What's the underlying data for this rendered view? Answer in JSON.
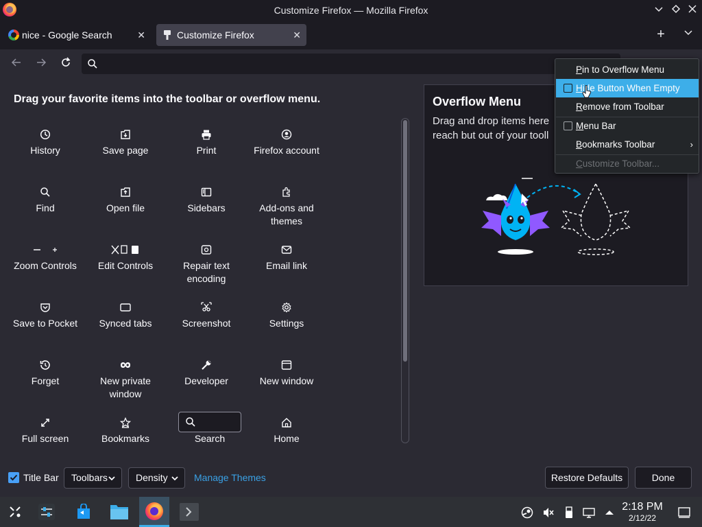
{
  "window": {
    "title": "Customize Firefox — Mozilla Firefox"
  },
  "tabs": [
    {
      "label": "nice - Google Search",
      "icon": "google-icon",
      "active": false
    },
    {
      "label": "Customize Firefox",
      "icon": "paintbrush-icon",
      "active": true
    }
  ],
  "navbar": {
    "url_value": ""
  },
  "customize": {
    "heading": "Drag your favorite items into the toolbar or overflow menu.",
    "items": [
      {
        "label": "History",
        "icon": "history-icon"
      },
      {
        "label": "Save page",
        "icon": "save-page-icon"
      },
      {
        "label": "Print",
        "icon": "print-icon"
      },
      {
        "label": "Firefox account",
        "icon": "account-icon"
      },
      {
        "label": "Find",
        "icon": "find-icon"
      },
      {
        "label": "Open file",
        "icon": "open-file-icon"
      },
      {
        "label": "Sidebars",
        "icon": "sidebars-icon"
      },
      {
        "label": "Add-ons and themes",
        "icon": "addons-icon"
      },
      {
        "label": "Zoom Controls",
        "icon": "zoom-icon"
      },
      {
        "label": "Edit Controls",
        "icon": "edit-controls-icon"
      },
      {
        "label": "Repair text encoding",
        "icon": "text-encoding-icon"
      },
      {
        "label": "Email link",
        "icon": "email-icon"
      },
      {
        "label": "Save to Pocket",
        "icon": "pocket-icon"
      },
      {
        "label": "Synced tabs",
        "icon": "synced-tabs-icon"
      },
      {
        "label": "Screenshot",
        "icon": "screenshot-icon"
      },
      {
        "label": "Settings",
        "icon": "settings-icon"
      },
      {
        "label": "Forget",
        "icon": "forget-icon"
      },
      {
        "label": "New private window",
        "icon": "private-window-icon"
      },
      {
        "label": "Developer",
        "icon": "developer-icon"
      },
      {
        "label": "New window",
        "icon": "new-window-icon"
      },
      {
        "label": "Full screen",
        "icon": "fullscreen-icon"
      },
      {
        "label": "Bookmarks",
        "icon": "bookmarks-icon"
      },
      {
        "label": "Search",
        "icon": "search-icon"
      },
      {
        "label": "Home",
        "icon": "home-icon"
      }
    ]
  },
  "overflow_panel": {
    "title": "Overflow Menu",
    "description_line1": "Drag and drop items here",
    "description_line2": "reach but out of your tooll"
  },
  "bottom_bar": {
    "title_bar_label": "Title Bar",
    "title_bar_checked": true,
    "toolbars_label": "Toolbars",
    "density_label": "Density",
    "manage_themes_label": "Manage Themes",
    "restore_defaults_label": "Restore Defaults",
    "done_label": "Done"
  },
  "context_menu": {
    "items": [
      {
        "pre": "",
        "accel": "P",
        "post": "in to Overflow Menu",
        "checkbox": false,
        "highlighted": false,
        "disabled": false
      },
      {
        "pre": "",
        "accel": "H",
        "post": "ide Button When Empty",
        "checkbox": true,
        "checked": false,
        "highlighted": true,
        "disabled": false
      },
      {
        "pre": "",
        "accel": "R",
        "post": "emove from Toolbar",
        "checkbox": false,
        "highlighted": false,
        "disabled": false
      },
      {
        "pre": "",
        "accel": "M",
        "post": "enu Bar",
        "checkbox": true,
        "checked": false,
        "highlighted": false,
        "disabled": false
      },
      {
        "pre": "",
        "accel": "B",
        "post": "ookmarks Toolbar",
        "checkbox": false,
        "highlighted": false,
        "disabled": false,
        "submenu": true
      },
      {
        "pre": "",
        "accel": "C",
        "post": "ustomize Toolbar...",
        "checkbox": false,
        "highlighted": false,
        "disabled": true
      }
    ]
  },
  "taskbar": {
    "time": "2:18 PM",
    "date": "2/12/22"
  },
  "colors": {
    "accent": "#3daee9",
    "link": "#3aa1e6",
    "checkbox": "#48a0f7",
    "background": "#2b2a33",
    "chrome": "#1c1b22"
  }
}
